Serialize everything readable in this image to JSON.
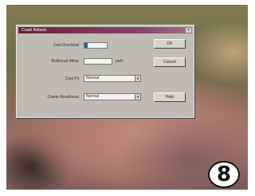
{
  "dialog": {
    "title": "Crash Reboot",
    "close": "×",
    "fields": [
      {
        "label": "Cast Overboat",
        "value": ""
      },
      {
        "label": "Bulkhead Mimp",
        "value": "",
        "unit": "path"
      }
    ],
    "selects": [
      {
        "label": "Cast Fit",
        "value": "Normal"
      },
      {
        "label": "Cowar Readiness",
        "value": "Normal"
      }
    ],
    "buttons": {
      "ok": "OK",
      "cancel": "Cancel",
      "help": "Help"
    }
  },
  "badge": {
    "number": "8"
  },
  "colors": {
    "titlebar": "#6a2040",
    "dialog": "#bfbcb6",
    "field_accent": "#3355cc"
  }
}
